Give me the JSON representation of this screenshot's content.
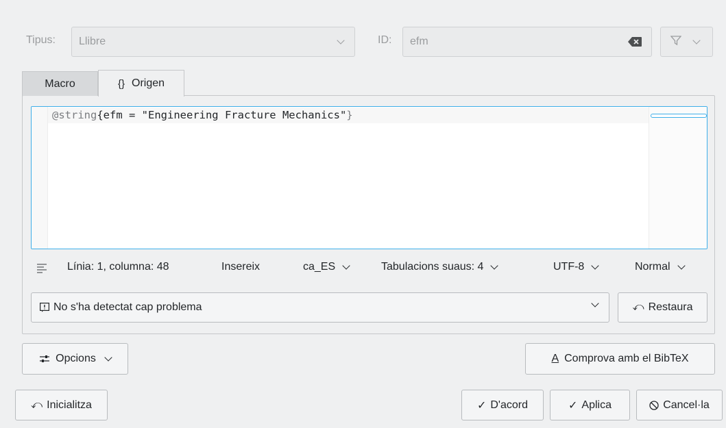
{
  "header": {
    "type_label": "Tipus:",
    "type_value": "Llibre",
    "id_label": "ID:",
    "id_value": "efm"
  },
  "tabs": [
    {
      "label": "Macro",
      "active": false
    },
    {
      "label": "Origen",
      "icon": "{}",
      "active": true
    }
  ],
  "editor": {
    "code_keyword": "@string",
    "code_open": "{",
    "code_body": "efm = \"Engineering Fracture Mechanics\"",
    "code_close": "}"
  },
  "statusbar": {
    "position": "Línia: 1, columna: 48",
    "mode": "Insereix",
    "language": "ca_ES",
    "tabs": "Tabulacions suaus: 4",
    "encoding": "UTF-8",
    "highlight": "Normal"
  },
  "problems": {
    "message": "No s'ha detectat cap problema",
    "restore_label": "Restaura"
  },
  "buttons": {
    "options": "Opcions",
    "check_bibtex": "Comprova amb el BibTeX",
    "reset": "Inicialitza",
    "ok": "D'acord",
    "apply": "Aplica",
    "cancel": "Cancel·la"
  },
  "colors": {
    "accent": "#3daee9",
    "window_bg": "#eff0f1",
    "keyword": "#7b7d80"
  }
}
